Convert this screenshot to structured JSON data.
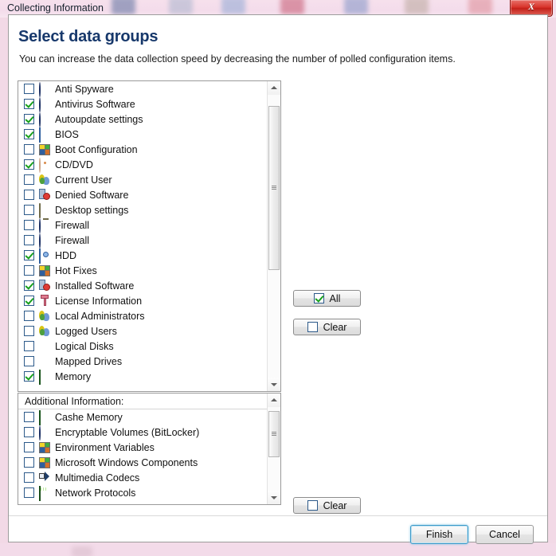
{
  "window": {
    "title": "Collecting Information",
    "close_label": "X",
    "close_icon": "close-icon"
  },
  "dialog": {
    "heading": "Select data groups",
    "subheading": "You can increase the data collection speed by decreasing the number of polled configuration items."
  },
  "main_list": {
    "items": [
      {
        "label": "Anti Spyware",
        "checked": false,
        "icon": "shield-icon"
      },
      {
        "label": "Antivirus Software",
        "checked": true,
        "icon": "shield-icon"
      },
      {
        "label": "Autoupdate settings",
        "checked": true,
        "icon": "shield-icon"
      },
      {
        "label": "BIOS",
        "checked": true,
        "icon": "chip-icon"
      },
      {
        "label": "Boot Configuration",
        "checked": false,
        "icon": "quad-squares-icon"
      },
      {
        "label": "CD/DVD",
        "checked": true,
        "icon": "disc-icon"
      },
      {
        "label": "Current User",
        "checked": false,
        "icon": "users-icon"
      },
      {
        "label": "Denied Software",
        "checked": false,
        "icon": "software-denied-icon"
      },
      {
        "label": "Desktop settings",
        "checked": false,
        "icon": "monitor-icon"
      },
      {
        "label": "Firewall",
        "checked": false,
        "icon": "shield-icon"
      },
      {
        "label": "Firewall",
        "checked": false,
        "icon": "shield-icon"
      },
      {
        "label": "HDD",
        "checked": true,
        "icon": "hdd-icon"
      },
      {
        "label": "Hot Fixes",
        "checked": false,
        "icon": "quad-squares-icon"
      },
      {
        "label": "Installed Software",
        "checked": true,
        "icon": "software-denied-icon"
      },
      {
        "label": "License Information",
        "checked": true,
        "icon": "key-icon"
      },
      {
        "label": "Local Administrators",
        "checked": false,
        "icon": "users-icon"
      },
      {
        "label": "Logged Users",
        "checked": false,
        "icon": "users-icon"
      },
      {
        "label": "Logical Disks",
        "checked": false,
        "icon": "pie-icon"
      },
      {
        "label": "Mapped Drives",
        "checked": false,
        "icon": "pie-icon"
      },
      {
        "label": "Memory",
        "checked": true,
        "icon": "ram-icon"
      }
    ],
    "scrollbar": {
      "thumb_top_pct": 4,
      "thumb_height_pct": 58
    }
  },
  "extra_list": {
    "header": "Additional Information:",
    "items": [
      {
        "label": "Cashe Memory",
        "checked": false,
        "icon": "ram-icon"
      },
      {
        "label": "Encryptable Volumes (BitLocker)",
        "checked": false,
        "icon": "shield-icon"
      },
      {
        "label": "Environment Variables",
        "checked": false,
        "icon": "quad-squares-icon"
      },
      {
        "label": "Microsoft Windows Components",
        "checked": false,
        "icon": "quad-squares-icon"
      },
      {
        "label": "Multimedia Codecs",
        "checked": false,
        "icon": "speaker-icon"
      },
      {
        "label": "Network Protocols",
        "checked": false,
        "icon": "netcard-icon"
      }
    ],
    "scrollbar": {
      "thumb_top_pct": 5,
      "thumb_height_pct": 55
    }
  },
  "side_buttons": {
    "all": {
      "label": "All",
      "checked": true
    },
    "clear_main": {
      "label": "Clear",
      "checked": false
    },
    "clear_extra": {
      "label": "Clear",
      "checked": false
    }
  },
  "footer": {
    "finish_label": "Finish",
    "cancel_label": "Cancel"
  },
  "colors": {
    "heading": "#17386b",
    "check": "#17a01c",
    "close_button": "#c32018",
    "focus_ring": "#3c99c8",
    "desktop": "#f2d9e6"
  }
}
